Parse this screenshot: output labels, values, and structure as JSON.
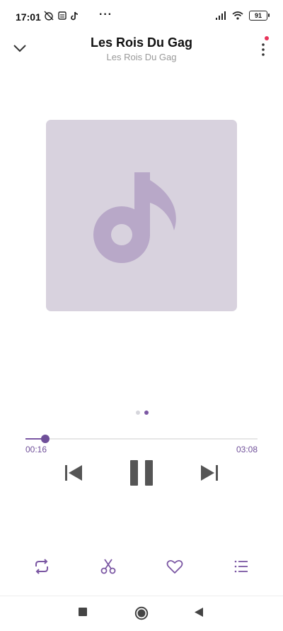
{
  "status_bar": {
    "time": "17:01",
    "overflow": "···",
    "battery_level": "91",
    "left_icons": [
      "alarm-off-icon",
      "sim-card-icon",
      "tiktok-icon"
    ],
    "right_icons": [
      "signal-icon",
      "wifi-icon",
      "battery-icon"
    ]
  },
  "header": {
    "title": "Les Rois Du Gag",
    "subtitle": "Les Rois Du Gag",
    "back_icon": "chevron-down-icon",
    "menu_icon": "more-vertical-icon"
  },
  "album_art": {
    "icon": "music-note-icon",
    "background": "#d8d2de",
    "icon_color": "#b8a8c8"
  },
  "pager": {
    "pages": 2,
    "active_index": 1
  },
  "player": {
    "elapsed": "00:16",
    "duration": "03:08",
    "progress_fraction": 0.085,
    "accent_color": "#7b57a3"
  },
  "controls": [
    "previous-icon",
    "pause-icon",
    "next-icon"
  ],
  "bottom_actions": [
    "repeat-icon",
    "scissors-icon",
    "heart-icon",
    "playlist-icon"
  ],
  "nav_bar": [
    "square-recents-icon",
    "circle-home-icon",
    "triangle-back-icon"
  ]
}
